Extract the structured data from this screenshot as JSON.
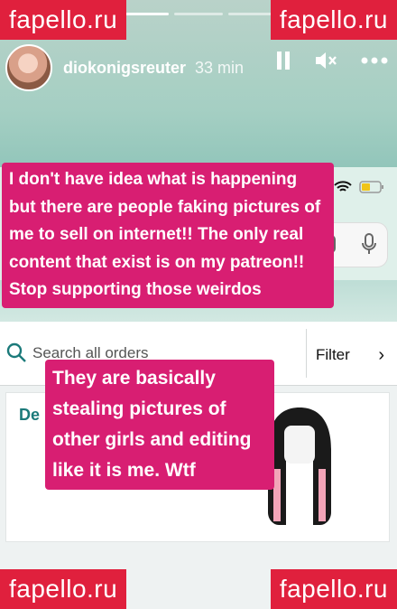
{
  "story": {
    "username": "diokonigsreuter",
    "time_ago": "33 min",
    "segments": 7,
    "segments_done": 3,
    "pause_icon": "pause-icon",
    "mute_icon": "speaker-muted-icon",
    "more_icon": "more-horizontal-icon"
  },
  "screenshot": {
    "search_placeholder": "Search all orders",
    "filter_label": "Filter",
    "card_title": "De"
  },
  "captions": {
    "first": "I don't have idea what is happening but there are people faking pictures of me to sell on internet!! The only real content that exist is on my patreon!! Stop supporting those weirdos",
    "second": "They are basically stealing pictures of other girls and editing like it is me. Wtf"
  },
  "watermark": {
    "text": "fapello.ru",
    "color": "#e0203d"
  },
  "colors": {
    "caption_bg": "#d81e72",
    "accent_teal": "#1b7a7a"
  }
}
